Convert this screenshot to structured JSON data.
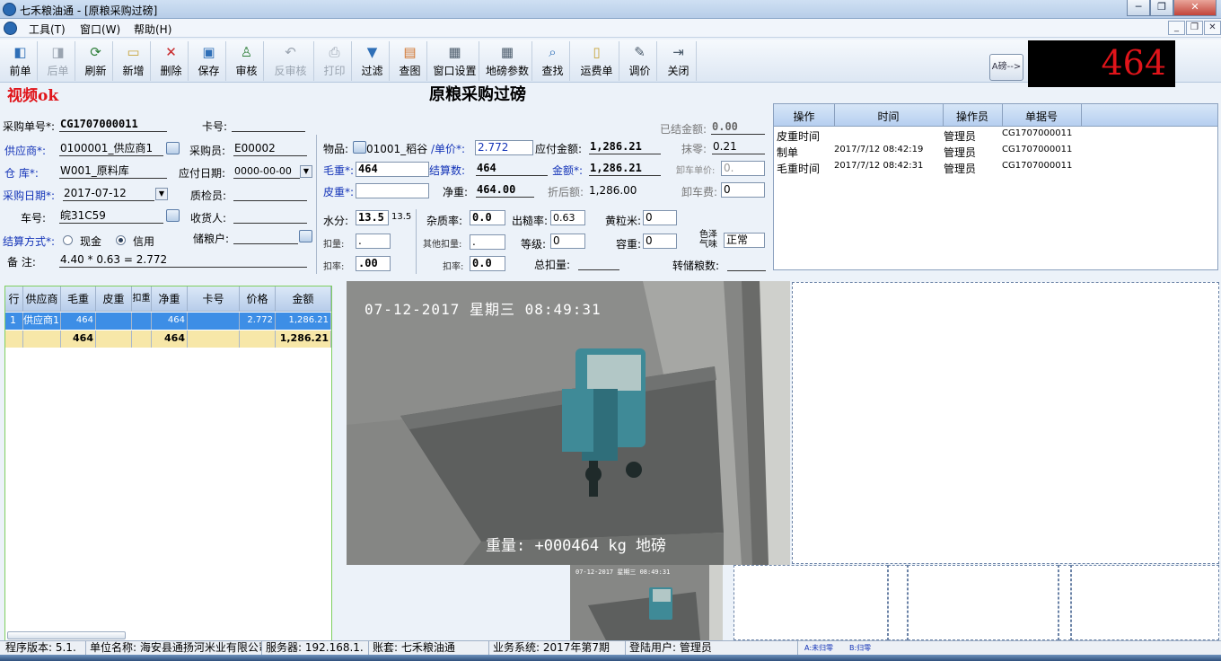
{
  "window": {
    "title": "七禾粮油通 - [原粮采购过磅]",
    "min": "─",
    "restore": "❐",
    "close": "✕"
  },
  "menu": [
    "工具(T)",
    "窗口(W)",
    "帮助(H)"
  ],
  "mdi": {
    "min": "_",
    "restore": "❐",
    "close": "✕"
  },
  "toolbar": [
    {
      "label": "前单",
      "icon": "◧",
      "enabled": true
    },
    {
      "label": "后单",
      "icon": "◨",
      "enabled": false
    },
    {
      "label": "刷新",
      "icon": "⟳",
      "enabled": true
    },
    {
      "label": "新增",
      "icon": "▭",
      "enabled": true
    },
    {
      "label": "删除",
      "icon": "✕",
      "enabled": true
    },
    {
      "label": "保存",
      "icon": "▣",
      "enabled": true
    },
    {
      "label": "审核",
      "icon": "♙",
      "enabled": true
    },
    {
      "label": "反审核",
      "icon": "↶",
      "enabled": false
    },
    {
      "label": "打印",
      "icon": "⎙",
      "enabled": false
    },
    {
      "label": "过滤",
      "icon": "▼",
      "enabled": true
    },
    {
      "label": "查图",
      "icon": "▤",
      "enabled": true
    },
    {
      "label": "窗口设置",
      "icon": "▦",
      "enabled": true
    },
    {
      "label": "地磅参数",
      "icon": "▦",
      "enabled": true
    },
    {
      "label": "查找",
      "icon": "⌕",
      "enabled": true
    },
    {
      "label": "运费单",
      "icon": "▯",
      "enabled": true
    },
    {
      "label": "调价",
      "icon": "✎",
      "enabled": true
    },
    {
      "label": "关闭",
      "icon": "⇥",
      "enabled": true
    }
  ],
  "scale": {
    "button": "A磅-->",
    "reading": "464"
  },
  "video_status": "视频ok",
  "form_title": "原粮采购过磅",
  "form": {
    "order_no_label": "采购单号*:",
    "order_no": "CG1707000011",
    "card_no_label": "卡号:",
    "card_no": "",
    "supplier_label": "供应商*:",
    "supplier": "0100001_供应商1",
    "buyer_label": "采购员:",
    "buyer": "E00002",
    "warehouse_label": "仓 库*:",
    "warehouse": "W001_原料库",
    "pay_date_label": "应付日期:",
    "pay_date": "0000-00-00",
    "purchase_date_label": "采购日期*:",
    "purchase_date": "2017-07-12",
    "inspector_label": "质检员:",
    "inspector": "",
    "plate_label": "车号:",
    "plate": "皖31C59",
    "receiver_label": "收货人:",
    "receiver": "",
    "settle_label": "结算方式*:",
    "settle_cash": "现金",
    "settle_credit": "信用",
    "storage_label": "储粮户:",
    "storage": "",
    "remark_label": "备 注:",
    "remark": "4.40 * 0.63 = 2.772",
    "goods_label": "物品:",
    "goods": "01001_稻谷",
    "unit_price_label": "/单价*:",
    "unit_price": "2.772",
    "payable_label": "应付金额:",
    "payable": "1,286.21",
    "settled_label": "已结金额:",
    "settled": "0.00",
    "rounding_label": "抹零:",
    "rounding": "0.21",
    "gross_label": "毛重*:",
    "gross": "464",
    "settle_qty_label": "结算数:",
    "settle_qty": "464",
    "amount_label": "金额*:",
    "amount": "1,286.21",
    "unload_price_label": "卸车单价:",
    "unload_price": "0.",
    "tare_label": "皮重*:",
    "tare": "",
    "net_label": "净重:",
    "net": "464.00",
    "discounted_label": "折后额:",
    "discounted": "1,286.00",
    "unload_fee_label": "卸车费:",
    "unload_fee": "0",
    "moisture_label": "水分:",
    "moisture": "13.5",
    "moisture_std": "13.5",
    "impurity_label": "杂质率:",
    "impurity": "0.0",
    "yield_label": "出糙率:",
    "yield": "0.63",
    "yellow_label": "黄粒米:",
    "yellow": "0",
    "deduct_label": "扣量:",
    "deduct": ".",
    "other_deduct_label": "其他扣量:",
    "other_deduct": ".",
    "grade_label": "等级:",
    "grade": "0",
    "density_label": "容重:",
    "density": "0",
    "color_label": "色泽气味",
    "color": "正常",
    "deduct_rate_label": "扣率:",
    "deduct_rate": ".00",
    "deduct_rate2_label": "扣率:",
    "deduct_rate2": "0.0",
    "total_deduct_label": "总扣量:",
    "total_deduct": "",
    "transfer_label": "转储粮数:",
    "transfer": ""
  },
  "oplog": {
    "headers": [
      "操作",
      "时间",
      "操作员",
      "单据号"
    ],
    "rows": [
      [
        "皮重时间",
        "",
        "管理员",
        "CG1707000011"
      ],
      [
        "制单",
        "2017/7/12 08:42:19",
        "管理员",
        "CG1707000011"
      ],
      [
        "毛重时间",
        "2017/7/12 08:42:31",
        "管理员",
        "CG1707000011"
      ]
    ]
  },
  "grid": {
    "headers": [
      "行",
      "供应商",
      "毛重",
      "皮重",
      "扣重",
      "净重",
      "卡号",
      "价格",
      "金额"
    ],
    "rows": [
      [
        "1",
        "供应商1",
        "464",
        "",
        "",
        "464",
        "",
        "2.772",
        "1,286.21"
      ]
    ],
    "total": [
      "",
      "",
      "464",
      "",
      "",
      "464",
      "",
      "",
      "1,286.21"
    ]
  },
  "camera": {
    "timestamp": "07-12-2017 星期三 08:49:31",
    "weight_text": "重量: +000464 kg  地磅",
    "thumb_timestamp": "07-12-2017 星期三 08:49:31"
  },
  "status": {
    "version": "程序版本: 5.1.",
    "unit": "单位名称: 海安县通扬河米业有限公司",
    "server": "服务器: 192.168.1.",
    "account": "账套: 七禾粮油通",
    "business": "业务系统: 2017年第7期",
    "user": "登陆用户: 管理员",
    "scale_a": "A:未归零",
    "scale_b": "B:归零"
  }
}
